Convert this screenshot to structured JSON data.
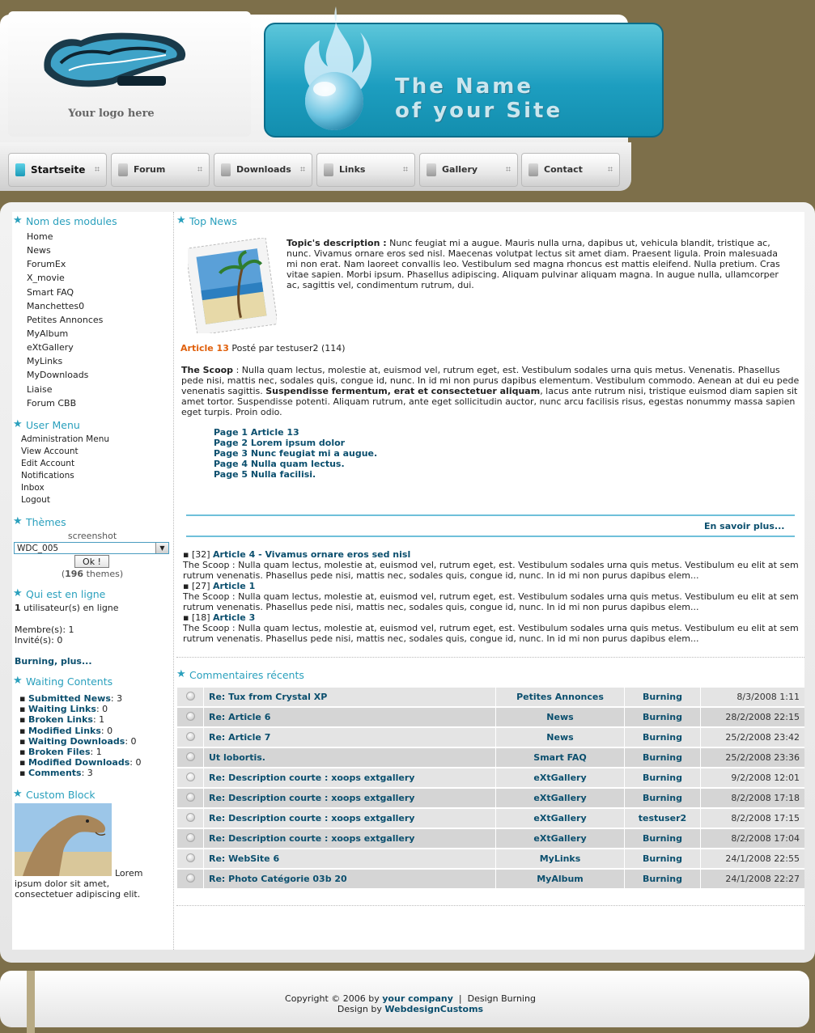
{
  "header": {
    "logo_caption": "Your logo here",
    "site_name": "The Name\nof your Site"
  },
  "nav": [
    {
      "label": "Startseite",
      "active": true
    },
    {
      "label": "Forum"
    },
    {
      "label": "Downloads"
    },
    {
      "label": "Links"
    },
    {
      "label": "Gallery"
    },
    {
      "label": "Contact"
    }
  ],
  "modules_block": {
    "title": "Nom des modules",
    "items": [
      "Home",
      "News",
      "ForumEx",
      "X_movie",
      "Smart FAQ",
      "Manchettes0",
      "Petites Annonces",
      "MyAlbum",
      "eXtGallery",
      "MyLinks",
      "MyDownloads",
      "Liaise",
      "Forum CBB"
    ]
  },
  "user_menu": {
    "title": "User Menu",
    "items": [
      "Administration Menu",
      "View Account",
      "Edit Account",
      "Notifications",
      "Inbox",
      "Logout"
    ]
  },
  "themes": {
    "title": "Thèmes",
    "screenshot_label": "screenshot",
    "selected": "WDC_005",
    "ok_label": "Ok !",
    "count": "196",
    "count_suffix": "themes"
  },
  "online": {
    "title": "Qui est en ligne",
    "count": "1",
    "count_text": "utilisateur(s) en ligne",
    "members": "Membre(s): 1",
    "guests": "Invité(s): 0",
    "burning_link": "Burning, plus..."
  },
  "waiting": {
    "title": "Waiting Contents",
    "items": [
      {
        "label": "Submitted News",
        "count": ": 3"
      },
      {
        "label": "Waiting Links",
        "count": ": 0"
      },
      {
        "label": "Broken Links",
        "count": ": 1"
      },
      {
        "label": "Modified Links",
        "count": ": 0"
      },
      {
        "label": "Waiting Downloads",
        "count": ": 0"
      },
      {
        "label": "Broken Files",
        "count": ": 1"
      },
      {
        "label": "Modified Downloads",
        "count": ": 0"
      },
      {
        "label": "Comments",
        "count": ": 3"
      }
    ]
  },
  "custom_block": {
    "title": "Custom Block",
    "text_first": "Lorem",
    "text_rest": "ipsum dolor sit amet,\nconsectetuer adipiscing elit."
  },
  "top_news": {
    "title": "Top News",
    "topic_label": "Topic's description :",
    "topic_text": "Nunc feugiat mi a augue. Mauris nulla urna, dapibus ut, vehicula blandit, tristique ac, nunc. Vivamus ornare eros sed nisl. Maecenas volutpat lectus sit amet diam. Praesent ligula. Proin malesuada mi non erat. Nam laoreet convallis leo. Vestibulum sed magna rhoncus est mattis eleifend. Nulla pretium. Cras vitae sapien. Morbi ipsum. Phasellus adipiscing. Aliquam pulvinar aliquam magna. In augue nulla, ullamcorper ac, sagittis vel, condimentum rutrum, dui.",
    "article_title": "Article 13",
    "article_meta": "Posté par testuser2 (114)",
    "scoop_label": "The Scoop",
    "scoop_text_1": ": Nulla quam lectus, molestie at, euismod vel, rutrum eget, est. Vestibulum sodales urna quis metus. Venenatis. Phasellus pede nisi, mattis nec, sodales quis, congue id, nunc. In id mi non purus dapibus elementum. Vestibulum commodo. Aenean at dui eu pede venenatis sagittis.",
    "scoop_bold": "Suspendisse fermentum, erat et consectetuer aliquam",
    "scoop_text_2": ", lacus ante rutrum nisi, tristique euismod diam sapien sit amet tortor. Suspendisse potenti. Aliquam rutrum, ante eget sollicitudin auctor, nunc arcu facilisis risus, egestas nonummy massa sapien eget turpis. Proin odio.",
    "pages": [
      "Page 1 Article 13",
      "Page 2 Lorem ipsum dolor",
      "Page 3 Nunc feugiat mi a augue.",
      "Page 4 Nulla quam lectus.",
      "Page 5 Nulla facilisi."
    ],
    "read_more": "En savoir plus...",
    "others": [
      {
        "count": "[32]",
        "title": "Article 4 - Vivamus ornare eros sed nisl",
        "text": "The Scoop : Nulla quam lectus, molestie at, euismod vel, rutrum eget, est. Vestibulum sodales urna quis metus. Vestibulum eu elit at sem rutrum venenatis. Phasellus pede nisi, mattis nec, sodales quis, congue id, nunc. In id mi non purus dapibus elem..."
      },
      {
        "count": "[27]",
        "title": "Article 1",
        "text": "The Scoop : Nulla quam lectus, molestie at, euismod vel, rutrum eget, est. Vestibulum sodales urna quis metus. Vestibulum eu elit at sem rutrum venenatis. Phasellus pede nisi, mattis nec, sodales quis, congue id, nunc. In id mi non purus dapibus elem..."
      },
      {
        "count": "[18]",
        "title": "Article 3",
        "text": "The Scoop : Nulla quam lectus, molestie at, euismod vel, rutrum eget, est. Vestibulum sodales urna quis metus. Vestibulum eu elit at sem rutrum venenatis. Phasellus pede nisi, mattis nec, sodales quis, congue id, nunc. In id mi non purus dapibus elem..."
      }
    ]
  },
  "comments": {
    "title": "Commentaires récents",
    "rows": [
      {
        "title": "Re: Tux from Crystal XP",
        "module": "Petites Annonces",
        "user": "Burning",
        "date": "8/3/2008 1:11",
        "icon": "radio"
      },
      {
        "title": "Re: Article 6",
        "module": "News",
        "user": "Burning",
        "date": "28/2/2008 22:15",
        "icon": "radio"
      },
      {
        "title": "Re: Article 7",
        "module": "News",
        "user": "Burning",
        "date": "25/2/2008 23:42",
        "icon": "radio"
      },
      {
        "title": "Ut lobortis.",
        "module": "Smart FAQ",
        "user": "Burning",
        "date": "25/2/2008 23:36",
        "icon": "radio"
      },
      {
        "title": "Re: Description courte : xoops extgallery",
        "module": "eXtGallery",
        "user": "Burning",
        "date": "9/2/2008 12:01",
        "icon": "smiley"
      },
      {
        "title": "Re: Description courte : xoops extgallery",
        "module": "eXtGallery",
        "user": "Burning",
        "date": "8/2/2008 17:18",
        "icon": "radio"
      },
      {
        "title": "Re: Description courte : xoops extgallery",
        "module": "eXtGallery",
        "user": "testuser2",
        "date": "8/2/2008 17:15",
        "icon": "radio"
      },
      {
        "title": "Re: Description courte : xoops extgallery",
        "module": "eXtGallery",
        "user": "Burning",
        "date": "8/2/2008 17:04",
        "icon": "radio"
      },
      {
        "title": "Re: WebSite 6",
        "module": "MyLinks",
        "user": "Burning",
        "date": "24/1/2008 22:55",
        "icon": "radio"
      },
      {
        "title": "Re: Photo Catégorie 03b 20",
        "module": "MyAlbum",
        "user": "Burning",
        "date": "24/1/2008 22:27",
        "icon": "radio"
      }
    ]
  },
  "footer": {
    "copyright_prefix": "Copyright © 2006 by",
    "company": "your company",
    "sep": "|",
    "design_burning": "Design Burning",
    "design_by": "Design by",
    "webdesign": "WebdesignCustoms"
  }
}
